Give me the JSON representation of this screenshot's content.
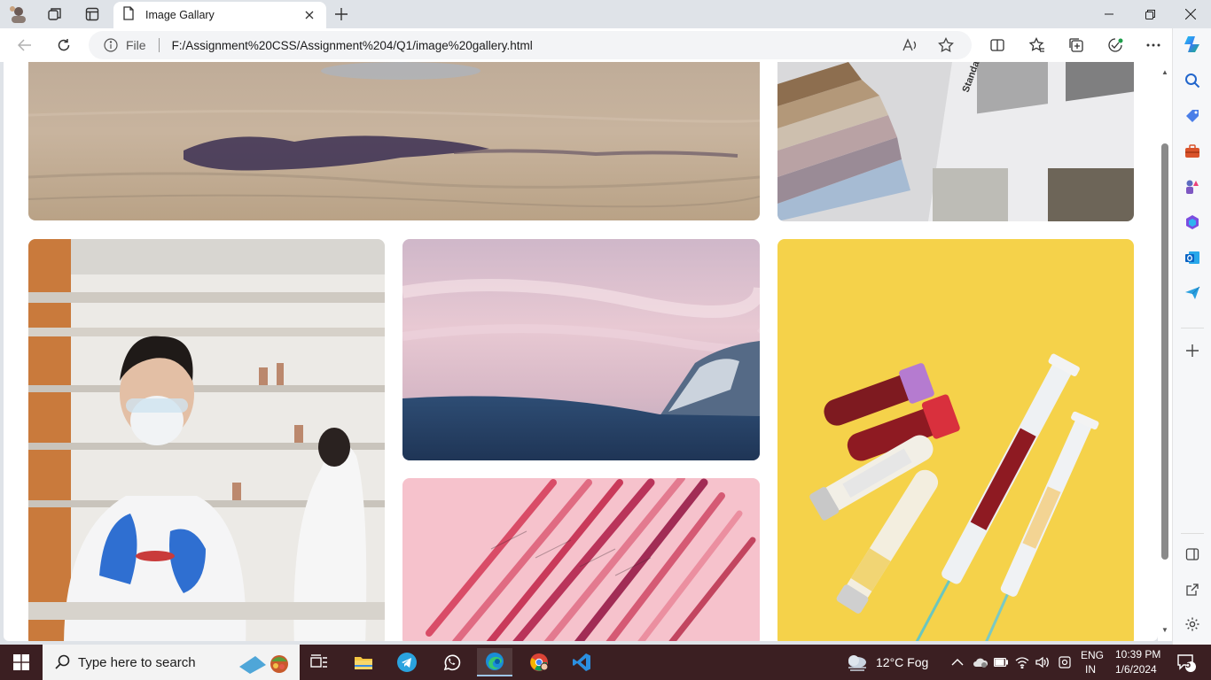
{
  "browser": {
    "tab_title": "Image Gallary",
    "scheme_label": "File",
    "url": "F:/Assignment%20CSS/Assignment%204/Q1/image%20gallery.html"
  },
  "gallery": {
    "images": [
      {
        "name": "desert-footprints",
        "description_colors": [
          "#c9b6a0",
          "#3a2e4a"
        ]
      },
      {
        "name": "paint-swatches",
        "description_colors": [
          "#e8e8e8",
          "#a9b6c5"
        ]
      },
      {
        "name": "lab-scientist",
        "description_colors": [
          "#f1f1f1",
          "#2f6fd1"
        ]
      },
      {
        "name": "pink-sky-mountain",
        "description_colors": [
          "#e8c0cf",
          "#274566"
        ]
      },
      {
        "name": "blood-syringes-yellow",
        "description_colors": [
          "#f5d24a",
          "#8e1a22"
        ]
      },
      {
        "name": "pink-syringes",
        "description_colors": [
          "#f6c2cc",
          "#b52d4a"
        ]
      }
    ]
  },
  "taskbar": {
    "search_placeholder": "Type here to search",
    "weather": "12°C  Fog",
    "lang_top": "ENG",
    "lang_bottom": "IN",
    "time": "10:39 PM",
    "date": "1/6/2024",
    "notifications": "5"
  },
  "colors": {
    "accent": "#0078d4",
    "taskbar_bg": "#3b1f22",
    "chrome_bg": "#dfe3e8"
  }
}
